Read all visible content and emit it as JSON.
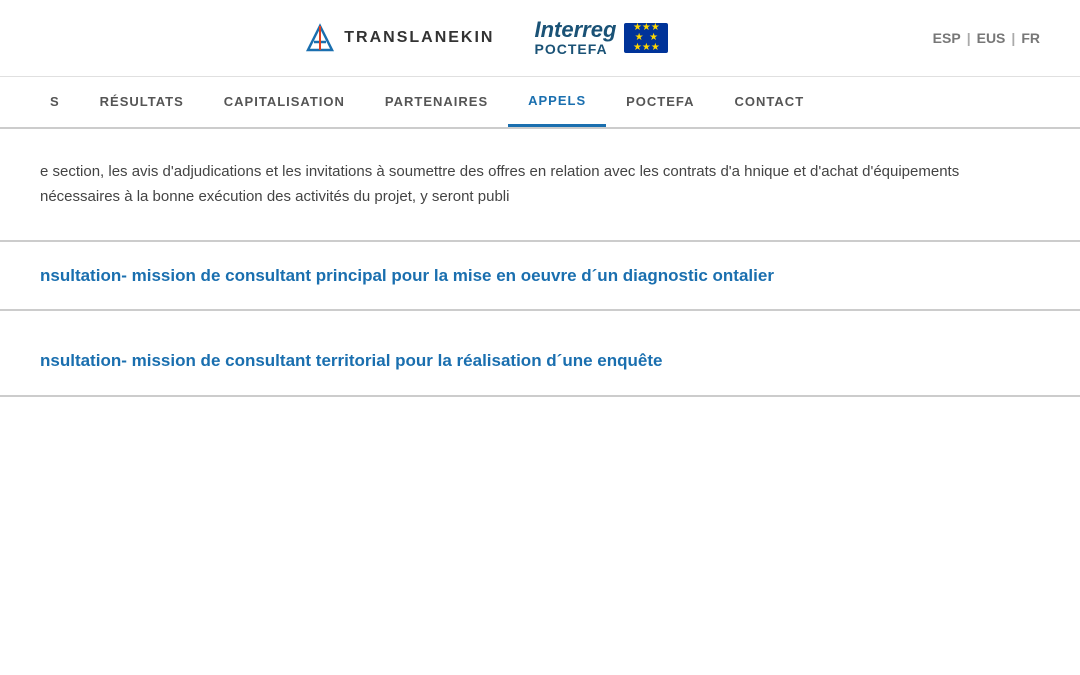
{
  "header": {
    "logo_translanekin": "TRANSLANEKIN",
    "logo_interreg_main": "Interreg",
    "logo_interreg_sub": "POCTEFA",
    "lang_esp": "ESP",
    "lang_eus": "EUS",
    "lang_fr": "FR",
    "sep1": "|",
    "sep2": "|"
  },
  "nav": {
    "items": [
      {
        "label": "S",
        "active": false
      },
      {
        "label": "RÉSULTATS",
        "active": false
      },
      {
        "label": "CAPITALISATION",
        "active": false
      },
      {
        "label": "PARTENAIRES",
        "active": false
      },
      {
        "label": "APPELS",
        "active": true
      },
      {
        "label": "POCTEFA",
        "active": false
      },
      {
        "label": "CONTACT",
        "active": false
      }
    ]
  },
  "intro": {
    "text": "e section, les avis d'adjudications et les invitations à soumettre des offres en relation avec les contrats d'a hnique et d'achat d'équipements nécessaires à la bonne exécution des activités du projet, y seront publi"
  },
  "appels": [
    {
      "title": "nsultation- mission de consultant principal pour la mise en oeuvre d´un diagnostic ontalier"
    },
    {
      "title": "nsultation- mission de consultant territorial pour la réalisation d´une enquête"
    }
  ]
}
